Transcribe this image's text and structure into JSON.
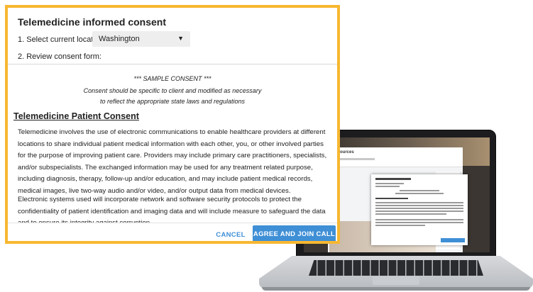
{
  "dialog": {
    "title": "Telemedicine informed consent",
    "step1_label": "1. Select current location:",
    "location_selected": "Washington",
    "step2_label": "2. Review consent form:",
    "sample_line1": "*** SAMPLE CONSENT ***",
    "sample_line2": "Consent should be specific to client and modified as necessary",
    "sample_line3": "to reflect the appropriate state laws and regulations",
    "heading": "Telemedicine Patient Consent",
    "paragraph1": "Telemedicine involves the use of electronic communications to enable healthcare providers at different locations to share individual patient medical information with each other, you, or other involved parties for the purpose of improving patient care. Providers may include primary care practitioners, specialists, and/or subspecialists. The exchanged information may be used for any treatment related purpose, including diagnosis, therapy, follow-up and/or education, and may include patient medical records, medical images, live two-way audio and/or video, and/or output data from medical devices.",
    "paragraph2": "Electronic systems used will incorporate network and software security protocols to protect the confidentiality of patient identification and imaging data and will include measure to safeguard the data and to ensure its integrity against corruption.",
    "cancel_label": "CANCEL",
    "agree_label": "AGREE AND JOIN CALL"
  },
  "colors": {
    "accent": "#3f8fd6",
    "highlight_border": "#f7b731"
  },
  "icons": {
    "dropdown": "caret-down-icon"
  }
}
